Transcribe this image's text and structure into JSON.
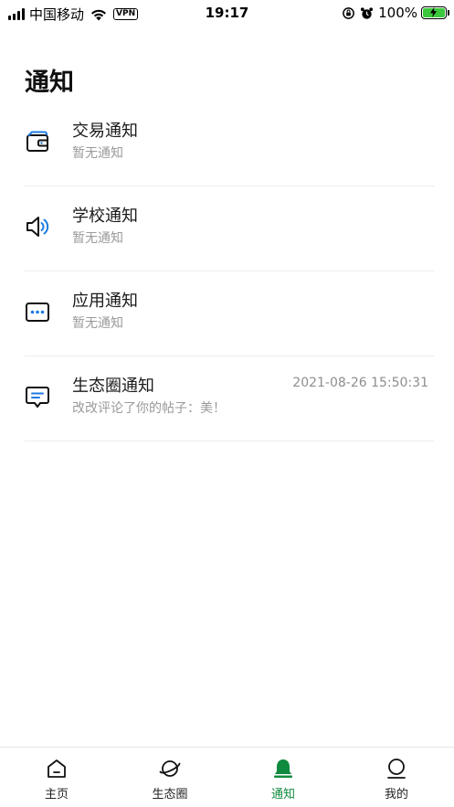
{
  "status_bar": {
    "carrier": "中国移动",
    "vpn": "VPN",
    "time": "19:17",
    "battery": "100%",
    "battery_level": 1.0
  },
  "page": {
    "title": "通知"
  },
  "notices": [
    {
      "title": "交易通知",
      "subtitle": "暂无通知",
      "time": "",
      "icon": "wallet-icon"
    },
    {
      "title": "学校通知",
      "subtitle": "暂无通知",
      "time": "",
      "icon": "speaker-icon"
    },
    {
      "title": "应用通知",
      "subtitle": "暂无通知",
      "time": "",
      "icon": "app-message-icon"
    },
    {
      "title": "生态圈通知",
      "subtitle": "改改评论了你的帖子：美！",
      "time": "2021-08-26 15:50:31",
      "icon": "chat-bubble-icon"
    }
  ],
  "tabs": [
    {
      "label": "主页",
      "icon": "home-icon",
      "active": false
    },
    {
      "label": "生态圈",
      "icon": "planet-icon",
      "active": false
    },
    {
      "label": "通知",
      "icon": "bell-icon",
      "active": true
    },
    {
      "label": "我的",
      "icon": "profile-icon",
      "active": false
    }
  ],
  "colors": {
    "accent": "#0f8a3e",
    "icon_blue": "#1e7be0",
    "text_secondary": "#9a9a9a"
  }
}
